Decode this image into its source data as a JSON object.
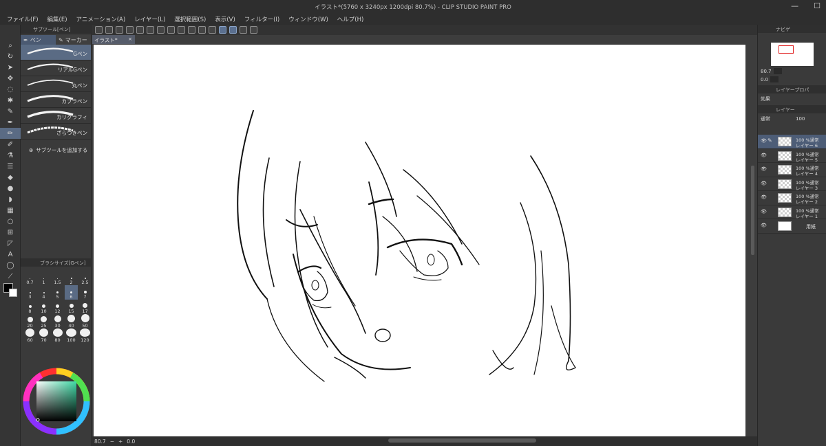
{
  "window": {
    "title": "イラスト*(5760 x 3240px 1200dpi 80.7%)  - CLIP STUDIO PAINT PRO",
    "controls": [
      "—",
      "☐"
    ]
  },
  "menu": [
    "ファイル(F)",
    "編集(E)",
    "アニメーション(A)",
    "レイヤー(L)",
    "選択範囲(S)",
    "表示(V)",
    "フィルター(I)",
    "ウィンドウ(W)",
    "ヘルプ(H)"
  ],
  "subtool": {
    "panel_title": "サブツール[ペン]",
    "groups": [
      "ペン",
      "マーカー"
    ],
    "brushes": [
      "Gペン",
      "リアルGペン",
      "丸ペン",
      "カブラペン",
      "カリグラフィ",
      "ざらつきペン"
    ],
    "selected_brush": "Gペン",
    "add_label": "サブツールを追加する"
  },
  "brush_size": {
    "panel_title": "ブラシサイズ[Gペン]",
    "sizes": [
      "0.7",
      "1",
      "1.5",
      "2",
      "2.5",
      "3",
      "4",
      "5",
      "6",
      "7",
      "8",
      "10",
      "12",
      "15",
      "17",
      "20",
      "25",
      "30",
      "40",
      "50",
      "60",
      "70",
      "80",
      "100",
      "120"
    ],
    "selected": "6"
  },
  "canvas": {
    "tab_label": "イラスト*",
    "tab_close": "×"
  },
  "statusbar": {
    "zoom": "80.7",
    "angle": "0.0"
  },
  "navigator": {
    "panel_title": "ナビゲ",
    "zoom": "80.7",
    "angle": "0.0"
  },
  "layer_property": {
    "panel_title": "レイヤープロパ",
    "effect_label": "効果"
  },
  "layers_panel": {
    "panel_title": "レイヤー",
    "blend_mode": "通常",
    "opacity": "100",
    "layers": [
      {
        "line1": "100 %通常",
        "line2": "レイヤー 6",
        "selected": true
      },
      {
        "line1": "100 %通常",
        "line2": "レイヤー 5",
        "selected": false
      },
      {
        "line1": "100 %通常",
        "line2": "レイヤー 4",
        "selected": false
      },
      {
        "line1": "100 %通常",
        "line2": "レイヤー 3",
        "selected": false
      },
      {
        "line1": "100 %通常",
        "line2": "レイヤー 2",
        "selected": false
      },
      {
        "line1": "100 %通常",
        "line2": "レイヤー 1",
        "selected": false
      }
    ],
    "paper_label": "用紙"
  },
  "colors": {
    "accent": "#5a6b84",
    "panel": "#3a3a3a",
    "canvas_bg": "#ffffff"
  }
}
